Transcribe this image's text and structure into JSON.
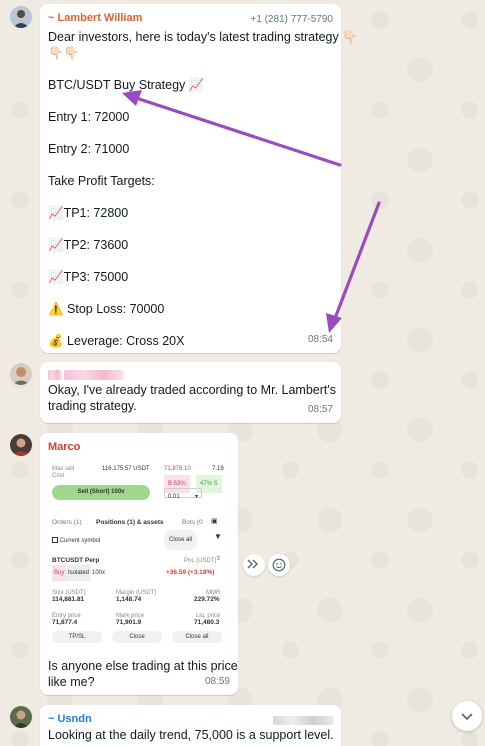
{
  "colors": {
    "sender_lambert": "#e0642c",
    "sender_marco": "#d63b2f",
    "sender_usndn": "#1f7aec",
    "arrow": "#9b4bc0",
    "sell_green": "#9fd88a"
  },
  "messages": [
    {
      "sender": "~ Lambert William",
      "phone": "+1 (281) 777-5790",
      "lines": [
        "Dear investors, here is today's latest trading strategy 👇🏻",
        "👇🏻👇🏻",
        "",
        "BTC/USDT Buy Strategy 📈",
        "",
        "Entry 1: 72000",
        "",
        "Entry 2: 71000",
        "",
        "Take Profit Targets:",
        "",
        "📈TP1: 72800",
        "",
        "📈TP2: 73600",
        "",
        "📈TP3: 75000",
        "",
        "⚠️ Stop Loss: 70000",
        "",
        "💰 Leverage: Cross 20X"
      ],
      "time": "08:54"
    },
    {
      "text_lines": [
        "Okay, I've already traded according to Mr. Lambert's",
        "trading strategy."
      ],
      "time": "08:57"
    },
    {
      "sender": "Marco",
      "caption_lines": [
        "Is anyone else trading at this price",
        "like me?"
      ],
      "time": "08:59",
      "screenshot": {
        "max_sell_label": "Max sell",
        "cost_label": "Cost",
        "max_sell_value": "116,175.57 USDT",
        "price1": "71,878.10",
        "qty1": "7.19",
        "pct_b": "B 53%",
        "pct_s": "47% S",
        "sell_button": "Sell (Short) 100x",
        "step_value": "0.01",
        "tab_orders": "Orders (1)",
        "tab_positions": "Positions (1) & assets",
        "tab_bots": "Bots (0",
        "current_symbol": "Current symbol",
        "close_all_top": "Close all",
        "pair": "BTCUSDT Perp",
        "pnl_label": "PnL (USDT)",
        "tag_buy": "Buy",
        "tag_isolated": "Isolated",
        "tag_leverage": "100x",
        "pnl_value": "+36.59 (+3.18%)",
        "size_label": "Size (USDT)",
        "size_value": "114,881.81",
        "margin_label": "Margin (USDT)",
        "margin_value": "1,148.74",
        "mmr_label": "MMR",
        "mmr_value": "229.72%",
        "entry_label": "Entry price",
        "entry_value": "71,877.4",
        "mark_label": "Mark price",
        "mark_value": "71,901.9",
        "liq_label": "Liq. price",
        "liq_value": "71,480.3",
        "btn_tpsl": "TP/SL",
        "btn_close": "Close",
        "btn_close_all": "Close all"
      }
    },
    {
      "sender": "~ Usndn",
      "text": "Looking at the daily trend, 75,000 is a support level."
    }
  ],
  "icons": {
    "forward": "forward-icon",
    "emoji": "emoji-icon",
    "scroll_down": "chevron-down-icon"
  }
}
